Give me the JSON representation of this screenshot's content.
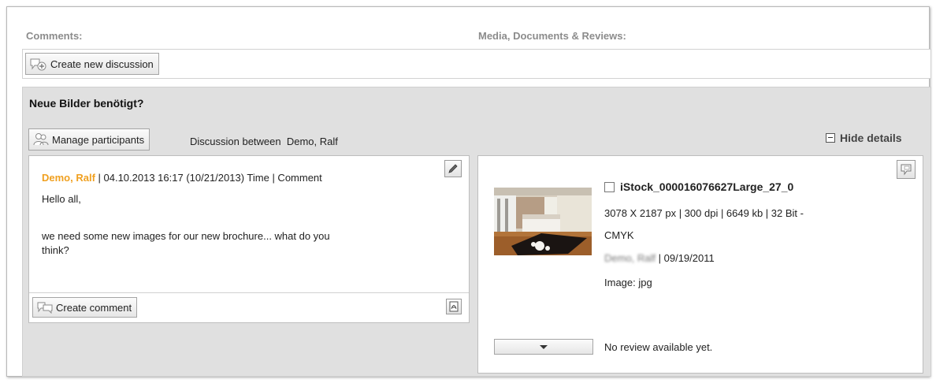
{
  "header": {
    "comments_label": "Comments:",
    "media_label": "Media, Documents & Reviews:"
  },
  "toolbar": {
    "create_discussion_label": "Create new discussion"
  },
  "discussion": {
    "title": "Neue Bilder benötigt?",
    "manage_participants_label": "Manage participants",
    "between_label": "Discussion between",
    "participants": "Demo, Ralf",
    "hide_details_label": "Hide details",
    "comment": {
      "author": "Demo, Ralf",
      "meta": " | 04.10.2013 16:17 (10/21/2013) Time | Comment",
      "line1": "Hello all,",
      "line2": "we need some new images for our new brochure... what do you",
      "line3": "think?"
    },
    "create_comment_label": "Create comment"
  },
  "media": {
    "filename": "iStock_000016076627Large_27_0",
    "info_line1": "3078 X 2187 px | 300 dpi | 6649 kb | 32 Bit -",
    "info_line2": "CMYK",
    "uploader_blurred": "Demo, Ralf",
    "date": " | 09/19/2011",
    "type": "Image: jpg",
    "review_status": "No review available yet."
  }
}
